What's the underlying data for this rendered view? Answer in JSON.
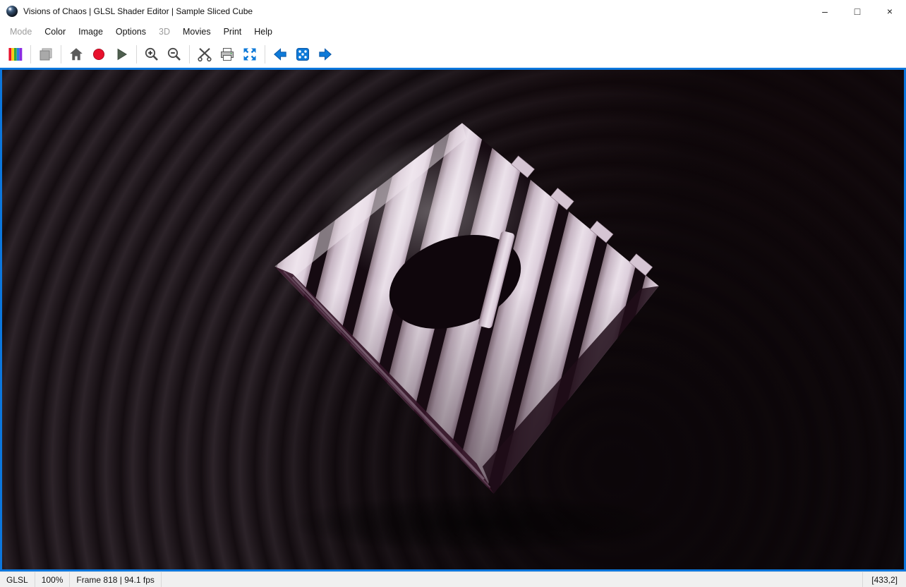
{
  "window": {
    "title": "Visions of Chaos | GLSL Shader Editor | Sample Sliced Cube",
    "minimize": "–",
    "maximize": "□",
    "close": "×"
  },
  "menu": {
    "items": [
      {
        "label": "Mode",
        "enabled": false
      },
      {
        "label": "Color",
        "enabled": true
      },
      {
        "label": "Image",
        "enabled": true
      },
      {
        "label": "Options",
        "enabled": true
      },
      {
        "label": "3D",
        "enabled": false
      },
      {
        "label": "Movies",
        "enabled": true
      },
      {
        "label": "Print",
        "enabled": true
      },
      {
        "label": "Help",
        "enabled": true
      }
    ]
  },
  "toolbar": {
    "buttons": [
      {
        "icon": "palette-icon",
        "enabled": true
      },
      {
        "icon": "stop-icon",
        "enabled": false
      },
      {
        "icon": "home-icon",
        "enabled": true
      },
      {
        "icon": "record-icon",
        "enabled": true
      },
      {
        "icon": "play-icon",
        "enabled": true
      },
      {
        "icon": "zoom-in-icon",
        "enabled": true
      },
      {
        "icon": "zoom-out-icon",
        "enabled": true
      },
      {
        "icon": "edit-tools-icon",
        "enabled": true
      },
      {
        "icon": "print-icon",
        "enabled": true
      },
      {
        "icon": "fullscreen-icon",
        "enabled": true
      },
      {
        "icon": "previous-icon",
        "enabled": true
      },
      {
        "icon": "random-dice-icon",
        "enabled": true
      },
      {
        "icon": "next-icon",
        "enabled": true
      }
    ],
    "accent_blue": "#0e7ad8",
    "record_red": "#e8112d"
  },
  "viewport": {
    "scene": "sliced-cube-3d-render",
    "border_color": "#0c77dd",
    "background_color": "#0e0709",
    "object_primary": "#d8c9d5",
    "object_shadow": "#2a0f20"
  },
  "statusbar": {
    "mode": "GLSL",
    "zoom": "100%",
    "frame_info": "Frame 818 | 94.1 fps",
    "coords": "[433,2]"
  }
}
